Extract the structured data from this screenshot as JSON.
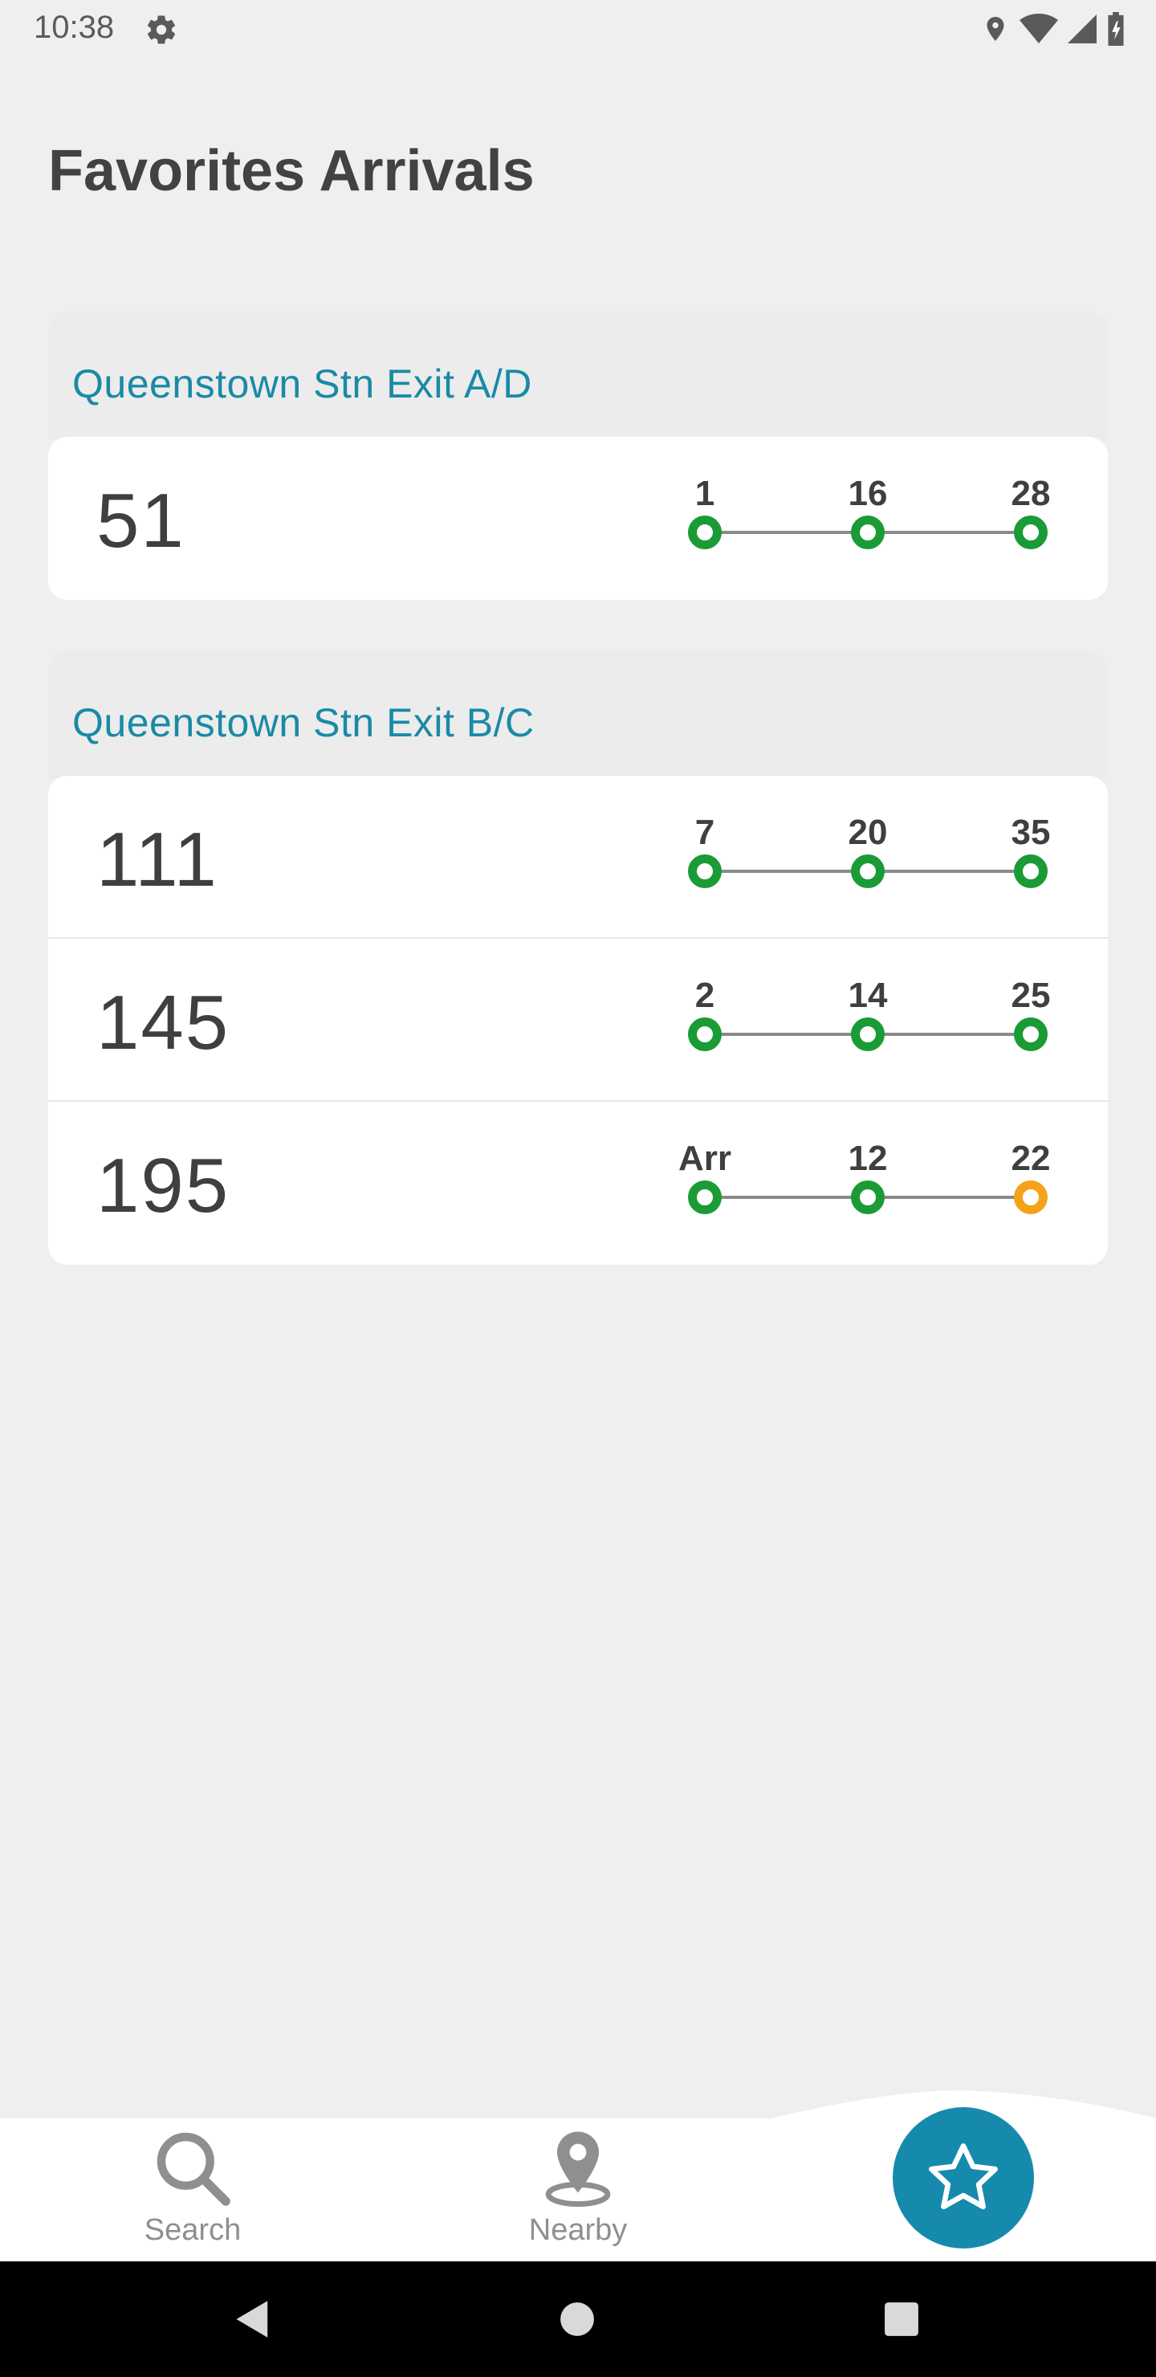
{
  "status_bar": {
    "time": "10:38",
    "left_icon": "gear-icon",
    "right_icons": [
      "location-icon",
      "wifi-icon",
      "signal-icon",
      "battery-icon"
    ]
  },
  "page": {
    "title": "Favorites Arrivals"
  },
  "groups": [
    {
      "title": "Queenstown Stn Exit A/D",
      "services": [
        {
          "number": "51",
          "arrivals": [
            {
              "label": "1",
              "status": "green"
            },
            {
              "label": "16",
              "status": "green"
            },
            {
              "label": "28",
              "status": "green"
            }
          ]
        }
      ]
    },
    {
      "title": "Queenstown Stn Exit B/C",
      "services": [
        {
          "number": "111",
          "arrivals": [
            {
              "label": "7",
              "status": "green"
            },
            {
              "label": "20",
              "status": "green"
            },
            {
              "label": "35",
              "status": "green"
            }
          ]
        },
        {
          "number": "145",
          "arrivals": [
            {
              "label": "2",
              "status": "green"
            },
            {
              "label": "14",
              "status": "green"
            },
            {
              "label": "25",
              "status": "green"
            }
          ]
        },
        {
          "number": "195",
          "arrivals": [
            {
              "label": "Arr",
              "status": "green"
            },
            {
              "label": "12",
              "status": "green"
            },
            {
              "label": "22",
              "status": "orange"
            }
          ]
        }
      ]
    }
  ],
  "bottom_nav": {
    "search_label": "Search",
    "nearby_label": "Nearby",
    "favorites_icon": "star-icon"
  },
  "colors": {
    "accent": "#168aad",
    "group_title": "#1a8aa6",
    "status_green": "#1a9b35",
    "status_orange": "#f5a21a"
  }
}
